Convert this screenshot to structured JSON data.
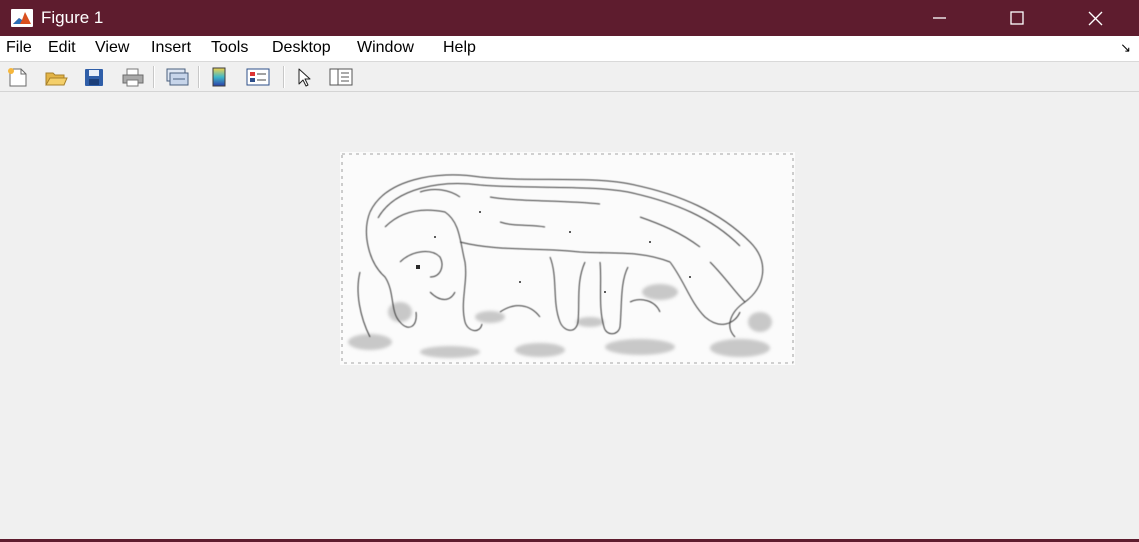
{
  "window": {
    "title": "Figure 1",
    "app_icon": "matlab-logo-icon",
    "controls": [
      "minimize-icon",
      "maximize-icon",
      "close-icon"
    ],
    "title_bar_color": "#5e1c2e"
  },
  "menubar": {
    "items": [
      "File",
      "Edit",
      "View",
      "Insert",
      "Tools",
      "Desktop",
      "Window",
      "Help"
    ],
    "dock_arrow": "↘"
  },
  "toolbar": {
    "buttons": [
      "new-figure-icon",
      "open-file-icon",
      "save-icon",
      "print-icon",
      "link-plot-icon",
      "insert-colorbar-icon",
      "insert-legend-icon",
      "edit-plot-icon",
      "property-inspector-icon"
    ]
  },
  "figure": {
    "content": "edge-detected-image"
  }
}
